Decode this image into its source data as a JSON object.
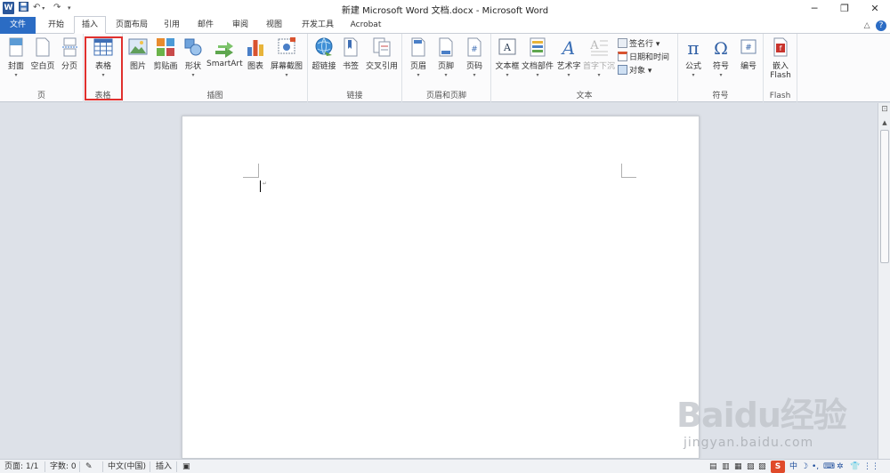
{
  "titlebar": {
    "app_icon": "W",
    "title": "新建 Microsoft Word 文档.docx - Microsoft Word",
    "save_icon": "save-icon",
    "undo_icon": "undo-icon",
    "redo_icon": "redo-icon",
    "minimize": "─",
    "restore": "❐",
    "close": "✕"
  },
  "tabs": {
    "file": "文件",
    "home": "开始",
    "insert": "插入",
    "page_layout": "页面布局",
    "references": "引用",
    "mailings": "邮件",
    "review": "审阅",
    "view": "视图",
    "developer": "开发工具",
    "acrobat": "Acrobat",
    "active": "插入"
  },
  "ribbon": {
    "groups": {
      "pages": {
        "label": "页",
        "cover": "封面",
        "blank": "空白页",
        "break": "分页"
      },
      "tables": {
        "label": "表格",
        "table": "表格"
      },
      "illustrations": {
        "label": "插图",
        "picture": "图片",
        "clipart": "剪贴画",
        "shapes": "形状",
        "smartart": "SmartArt",
        "chart": "图表",
        "screenshot": "屏幕截图"
      },
      "links": {
        "label": "链接",
        "hyperlink": "超链接",
        "bookmark": "书签",
        "crossref": "交叉引用"
      },
      "header_footer": {
        "label": "页眉和页脚",
        "header": "页眉",
        "footer": "页脚",
        "page_number": "页码"
      },
      "text": {
        "label": "文本",
        "textbox": "文本框",
        "quickparts": "文档部件",
        "wordart": "艺术字",
        "dropcap": "首字下沉",
        "signature": "签名行",
        "datetime": "日期和时间",
        "object": "对象"
      },
      "symbols": {
        "label": "符号",
        "equation": "公式",
        "symbol": "符号",
        "number": "编号"
      },
      "flash": {
        "label": "Flash",
        "embed_line1": "嵌入",
        "embed_line2": "Flash"
      }
    }
  },
  "document": {
    "paragraph_mark": "↵"
  },
  "statusbar": {
    "page": "页面: 1/1",
    "words": "字数: 0",
    "language": "中文(中国)",
    "mode": "插入"
  },
  "watermark": {
    "main": "Baidu经验",
    "sub": "jingyan.baidu.com"
  },
  "colors": {
    "file_tab": "#2b6cc4",
    "highlight": "#e0302e",
    "word_brand": "#2b579a"
  }
}
